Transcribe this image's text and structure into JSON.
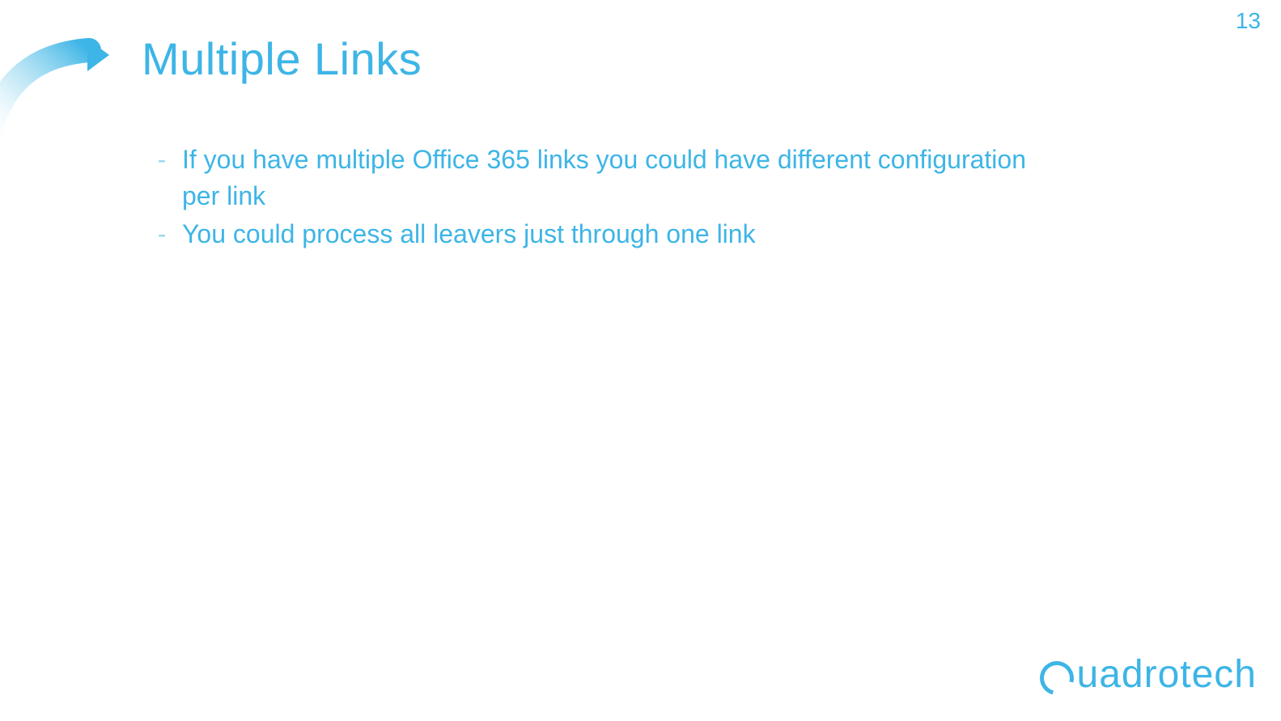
{
  "pageNumber": "13",
  "title": "Multiple Links",
  "bullets": [
    "If you have multiple Office 365 links you could have different configuration per link",
    "You could process all leavers just through one link"
  ],
  "logoText": "uadrotech"
}
